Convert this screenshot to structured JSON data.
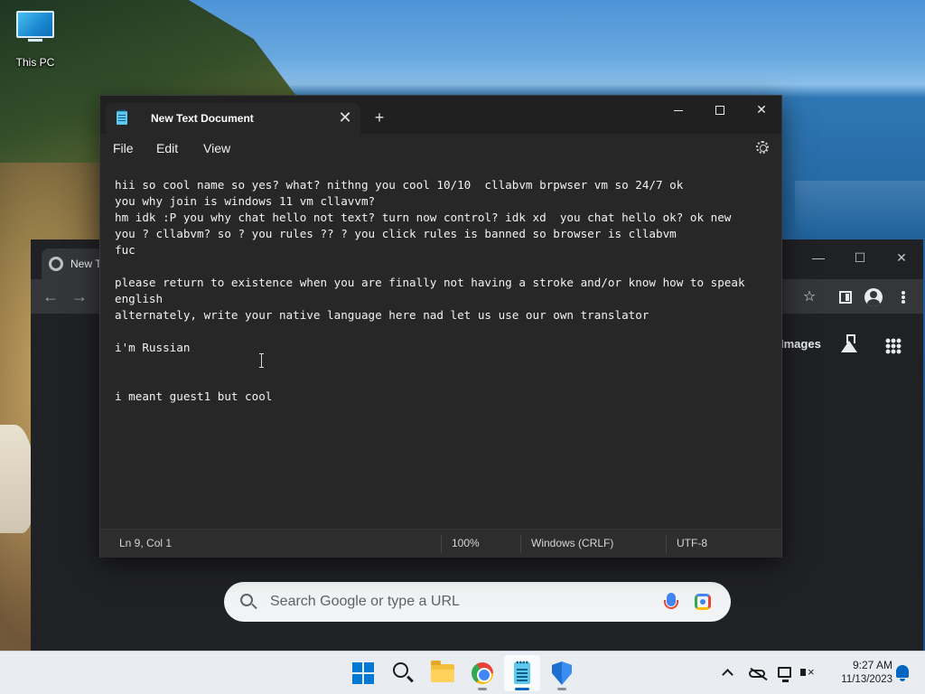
{
  "desktop": {
    "icons": [
      {
        "label": "This PC",
        "icon": "monitor-icon"
      }
    ]
  },
  "chrome": {
    "tab_title": "New T",
    "window_buttons": {
      "minimize": "—",
      "maximize": "☐",
      "close": "✕"
    },
    "nav": {
      "back": "←",
      "forward": "→"
    },
    "images_link": "Images",
    "search_placeholder": "Search Google or type a URL",
    "star": "☆"
  },
  "notepad": {
    "tab_title": "New Text Document",
    "tab_close": "✕",
    "new_tab": "+",
    "window_buttons": {
      "close": "✕"
    },
    "menu": {
      "file": "File",
      "edit": "Edit",
      "view": "View"
    },
    "content": "hii so cool name so yes? what? nithng you cool 10/10  cllabvm brpwser vm so 24/7 ok\nyou why join is windows 11 vm cllavvm?\nhm idk :P you why chat hello not text? turn now control? idk xd  you chat hello ok? ok new\nyou ? cllabvm? so ? you rules ?? ? you click rules is banned so browser is cllabvm\nfuc\n\nplease return to existence when you are finally not having a stroke and/or know how to speak\nenglish\nalternately, write your native language here nad let us use our own translator\n\ni'm Russian\n\n\ni meant guest1 but cool",
    "status": {
      "position": "Ln 9, Col 1",
      "zoom": "100%",
      "line_ending": "Windows (CRLF)",
      "encoding": "UTF-8"
    }
  },
  "taskbar": {
    "apps": [
      {
        "name": "start",
        "icon": "windows-logo-icon"
      },
      {
        "name": "search",
        "icon": "search-icon"
      },
      {
        "name": "file-explorer",
        "icon": "folder-icon"
      },
      {
        "name": "chrome",
        "icon": "chrome-icon"
      },
      {
        "name": "notepad",
        "icon": "notepad-icon",
        "active": true
      },
      {
        "name": "defender",
        "icon": "shield-icon"
      }
    ],
    "clock": {
      "time": "9:27 AM",
      "date": "11/13/2023"
    }
  },
  "colors": {
    "notepad_bg": "#272727",
    "taskbar_bg": "#e9edf2",
    "accent": "#0067c0",
    "windows_blue": "#0078d4"
  }
}
